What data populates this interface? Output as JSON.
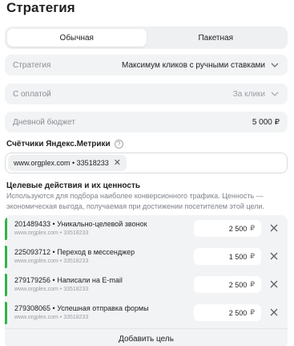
{
  "title": "Стратегия",
  "tabs": [
    {
      "label": "Обычная",
      "active": true
    },
    {
      "label": "Пакетная",
      "active": false
    }
  ],
  "strategy": {
    "label": "Стратегия",
    "value": "Максимум кликов с ручными ставками"
  },
  "payment": {
    "label": "С оплатой",
    "value": "За клики"
  },
  "budget": {
    "label": "Дневной бюджет",
    "value": "5 000 ₽"
  },
  "metrika": {
    "title": "Счётчики Яндекс.Метрики",
    "help_icon": "?",
    "chip": "www.orgplex.com • 33518233"
  },
  "goals": {
    "title": "Целевые действия и их ценность",
    "description": "Используются для подбора наиболее конверсионного трафика. Ценность — экономическая выгода, получаемая при достижении посетителем этой цели.",
    "items": [
      {
        "name": "201489433 • Уникально-целевой звонок",
        "sub": "www.orgplex.com • 33518233",
        "value": "2 500",
        "currency": "₽"
      },
      {
        "name": "225093712 • Переход в мессенджер",
        "sub": "www.orgplex.com • 33518233",
        "value": "1 500",
        "currency": "₽"
      },
      {
        "name": "279179256 • Написали на E-mail",
        "sub": "www.orgplex.com • 33518233",
        "value": "2 500",
        "currency": "₽"
      },
      {
        "name": "279308065 • Успешная отправка формы",
        "sub": "www.orgplex.com • 33518233",
        "value": "2 500",
        "currency": "₽"
      }
    ],
    "add_label": "Добавить цель"
  },
  "colors": {
    "accent_bar": "#2fb44a",
    "field_bg": "#f2f3f5"
  }
}
